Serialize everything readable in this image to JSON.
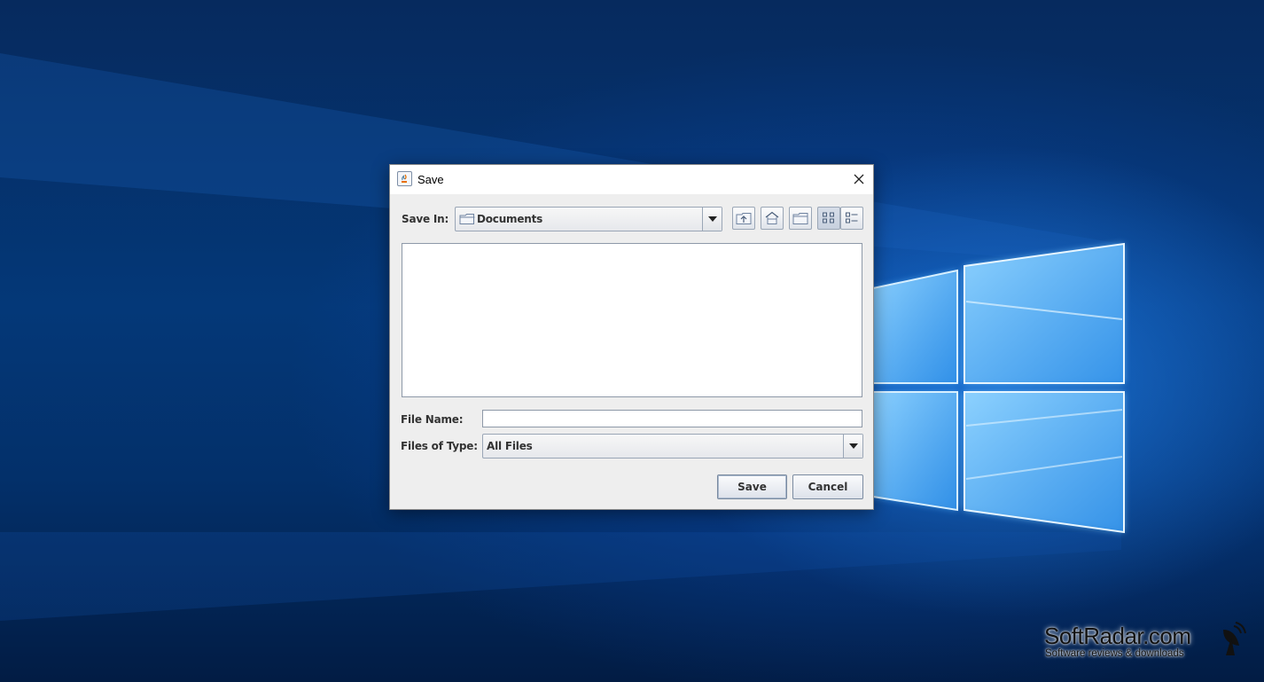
{
  "dialog": {
    "title": "Save",
    "save_in_label": "Save In:",
    "save_in_value": "Documents",
    "file_name_label": "File Name:",
    "file_name_value": "",
    "files_of_type_label": "Files of Type:",
    "files_of_type_value": "All Files",
    "save_button": "Save",
    "cancel_button": "Cancel"
  },
  "toolbar_icons": [
    "up-one-level-icon",
    "home-icon",
    "new-folder-icon",
    "list-view-icon",
    "details-view-icon"
  ],
  "watermark": {
    "title": "SoftRadar.com",
    "subtitle": "Software reviews & downloads"
  },
  "colors": {
    "desktop_background": "#043878",
    "dialog_background": "#eeeeee",
    "titlebar_background": "#ffffff"
  }
}
